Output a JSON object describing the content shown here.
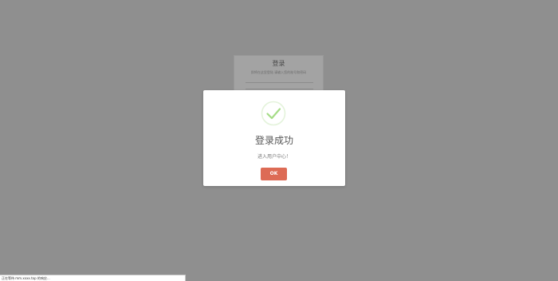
{
  "background_form": {
    "title": "登录",
    "subtitle": "即将在这里登陆 请输入您的账号和密码"
  },
  "modal": {
    "title": "登录成功",
    "message": "进入用户中心！",
    "ok_label": "OK",
    "icon": "checkmark-circle-icon",
    "accent_color": "#dd6b55",
    "success_color": "#a5dc86"
  },
  "status_bar": {
    "text": "正在等待 mm.xxxx.top 的响应..."
  }
}
